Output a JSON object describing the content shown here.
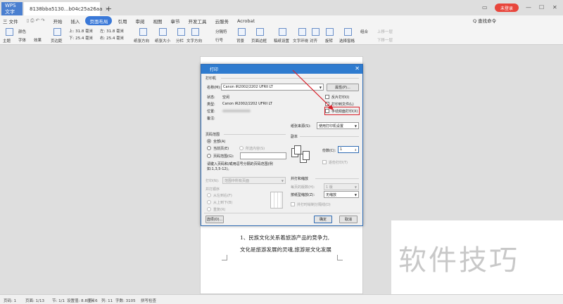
{
  "titlebar": {
    "app_tab": "WPS 文字",
    "doc_tab": "8138bba5130...b04c25a26aa",
    "new_tab": "+",
    "login": "未登录"
  },
  "menubar": {
    "file_menu": "三 文件",
    "items": [
      "开始",
      "插入",
      "页面布局",
      "引用",
      "审阅",
      "视图",
      "章节",
      "开发工具",
      "云服务",
      "Acrobat"
    ],
    "active_index": 2,
    "search": "Q 查找命令"
  },
  "ribbon": {
    "labels": [
      "主题",
      "颜色",
      "字体",
      "效果",
      "页边距",
      "纸张方向",
      "纸张大小",
      "分栏",
      "文字方向",
      "行号",
      "背景",
      "页面边框",
      "稿纸设置",
      "文字环绕",
      "对齐",
      "旋转",
      "选择窗格",
      "组合",
      "上移一层",
      "下移一层"
    ],
    "margin_top": "上: 31.8 毫米",
    "margin_bottom": "下: 25.4 毫米",
    "margin_left": "左: 31.8 毫米",
    "margin_right": "右: 25.4 毫米",
    "breaks": "分隔符"
  },
  "dialog": {
    "title": "打印",
    "printer_section": "打印机",
    "name_label": "名称(M):",
    "printer_name": "Canon iR2002/2202 UFRII LT",
    "properties_button": "属性(P)...",
    "status_label": "状态:",
    "status_value": "空闲",
    "type_label": "类型:",
    "type_value": "Canon iR2002/2202 UFRII LT",
    "location_label": "位置:",
    "note_label": "备注:",
    "reverse_print": "反片打印(I)",
    "print_to_file": "打印到文件(L)",
    "manual_duplex": "手动双面打印(X)",
    "paper_source_label": "纸张来源(S):",
    "paper_source_value": "使用打印机设置",
    "page_range_section": "页码范围",
    "range_all": "全部(A)",
    "range_current": "当前页(E)",
    "range_selection": "所选内容(S)",
    "range_pages": "页码范围(G):",
    "range_hint": "请键入页码和/或用逗号分隔的页码范围(例如:1,3,5-12)。",
    "print_label": "打印(N):",
    "print_value": "范围中所有页面",
    "order_section": "并打顺序",
    "order_ltr": "从左到右(F)",
    "order_ttb": "从上到下(B)",
    "order_repeat": "重复(R)",
    "copies_section": "副本",
    "copies_label": "份数(C):",
    "copies_value": "1",
    "collate": "逐份打印(T)",
    "zoom_section": "并打和缩放",
    "pages_per_sheet_label": "每页的版数(H):",
    "pages_per_sheet_value": "1 版",
    "scale_label": "按纸型缩放(Z):",
    "scale_value": "无缩放",
    "draw_border": "并打时绘制分隔线(D)",
    "options_button": "选项(O)...",
    "ok_button": "确定",
    "cancel_button": "取消"
  },
  "document": {
    "line1": "1、民族文化关系着旅游产品的竞争力,",
    "line2": "文化是旅游发展的灵魂,旅游是文化发展"
  },
  "statusbar": {
    "page": "页码: 1",
    "pages": "页面: 1/13",
    "section": "节: 1/1",
    "setting": "设置值: 8.8厘米",
    "row": "行: 6",
    "col": "列: 11",
    "words": "字数: 3105",
    "spell": "拼写检查"
  },
  "watermark": "软件技巧",
  "colors": {
    "accent": "#3978d8",
    "dialog_title": "#2e7bcf",
    "highlight": "#d8202a"
  }
}
